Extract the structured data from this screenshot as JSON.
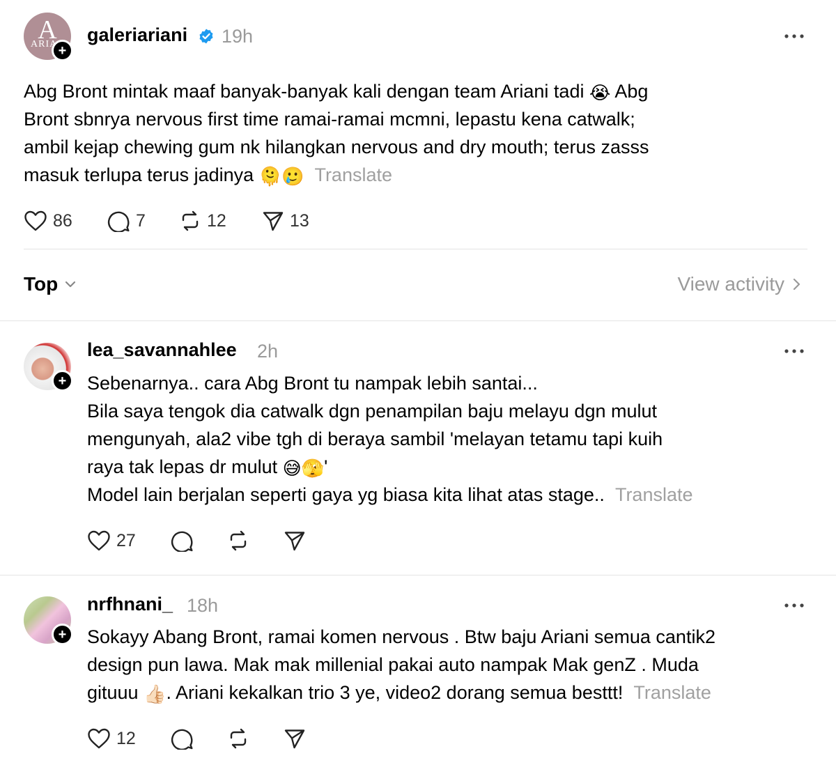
{
  "colors": {
    "verified": "#1d9bf0",
    "muted": "#9a9a9a",
    "divider": "#e4e4e4"
  },
  "main_post": {
    "avatar_logo_letter": "A",
    "avatar_logo_text": "ARIA",
    "username": "galeriariani",
    "time": "19h",
    "line1": "Abg Bront mintak maaf banyak-banyak kali dengan team Ariani tadi",
    "emoji1": "😭",
    "line1b": "Abg",
    "line2": "Bront sbnrya nervous first time ramai-ramai mcmni, lepastu kena catwalk;",
    "line3": "ambil kejap chewing gum nk hilangkan nervous and dry mouth; terus zasss",
    "line4": "masuk terlupa terus jadinya",
    "emoji2": "🫠",
    "emoji3": "🥲",
    "translate": "Translate",
    "likes": "86",
    "replies": "7",
    "reposts": "12",
    "shares": "13"
  },
  "filter": {
    "label": "Top",
    "view_activity": "View activity"
  },
  "replies": [
    {
      "username": "lea_savannahlee",
      "time": "2h",
      "line1": "Sebenarnya.. cara Abg Bront tu nampak lebih santai...",
      "line2": "Bila saya tengok dia catwalk dgn penampilan baju melayu dgn mulut",
      "line3": "mengunyah, ala2 vibe tgh di beraya sambil 'melayan tetamu tapi kuih",
      "line4": "raya tak lepas dr mulut",
      "emoji1": "😅",
      "emoji2": "🫣",
      "line4b": "'",
      "line5": "Model lain berjalan seperti gaya yg biasa kita lihat atas stage..",
      "translate": "Translate",
      "likes": "27"
    },
    {
      "username": "nrfhnani_",
      "time": "18h",
      "line1": "Sokayy Abang Bront, ramai komen nervous . Btw baju Ariani semua cantik2",
      "line2": "design pun lawa. Mak mak millenial pakai auto nampak Mak genZ . Muda",
      "line3a": "gituuu",
      "emoji1": "👍🏻",
      "line3b": ". Ariani kekalkan trio 3 ye, video2 dorang semua besttt!",
      "translate": "Translate",
      "likes": "12"
    }
  ]
}
